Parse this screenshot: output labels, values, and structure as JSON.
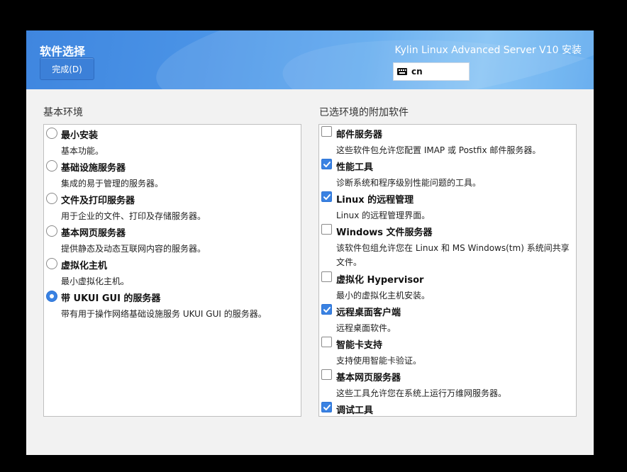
{
  "header": {
    "title": "软件选择",
    "done_button": "完成(D)",
    "product": "Kylin Linux Advanced Server V10 安装",
    "keyboard_layout": "cn",
    "keyboard_icon": "keyboard-icon"
  },
  "base_environment": {
    "title": "基本环境",
    "selected_index": 5,
    "items": [
      {
        "label": "最小安装",
        "desc": "基本功能。"
      },
      {
        "label": "基础设施服务器",
        "desc": "集成的易于管理的服务器。"
      },
      {
        "label": "文件及打印服务器",
        "desc": "用于企业的文件、打印及存储服务器。"
      },
      {
        "label": "基本网页服务器",
        "desc": "提供静态及动态互联网内容的服务器。"
      },
      {
        "label": "虚拟化主机",
        "desc": "最小虚拟化主机。"
      },
      {
        "label": "带 UKUI GUI 的服务器",
        "desc": "带有用于操作网络基础设施服务 UKUI GUI 的服务器。"
      }
    ]
  },
  "addons": {
    "title": "已选环境的附加软件",
    "items": [
      {
        "label": "邮件服务器",
        "desc": "这些软件包允许您配置 IMAP 或 Postfix 邮件服务器。",
        "checked": false
      },
      {
        "label": "性能工具",
        "desc": "诊断系统和程序级别性能问题的工具。",
        "checked": true
      },
      {
        "label": "Linux 的远程管理",
        "desc": "Linux 的远程管理界面。",
        "checked": true
      },
      {
        "label": "Windows 文件服务器",
        "desc": "该软件包组允许您在 Linux 和 MS Windows(tm) 系统间共享文件。",
        "checked": false
      },
      {
        "label": "虚拟化 Hypervisor",
        "desc": "最小的虚拟化主机安装。",
        "checked": false
      },
      {
        "label": "远程桌面客户端",
        "desc": "远程桌面软件。",
        "checked": true
      },
      {
        "label": "智能卡支持",
        "desc": "支持使用智能卡验证。",
        "checked": false
      },
      {
        "label": "基本网页服务器",
        "desc": "这些工具允许您在系统上运行万维网服务器。",
        "checked": false
      },
      {
        "label": "调试工具",
        "desc": "",
        "checked": true
      }
    ]
  },
  "colors": {
    "accent": "#3a82e2",
    "header_start": "#3f86df",
    "header_end": "#7fc0f4"
  }
}
